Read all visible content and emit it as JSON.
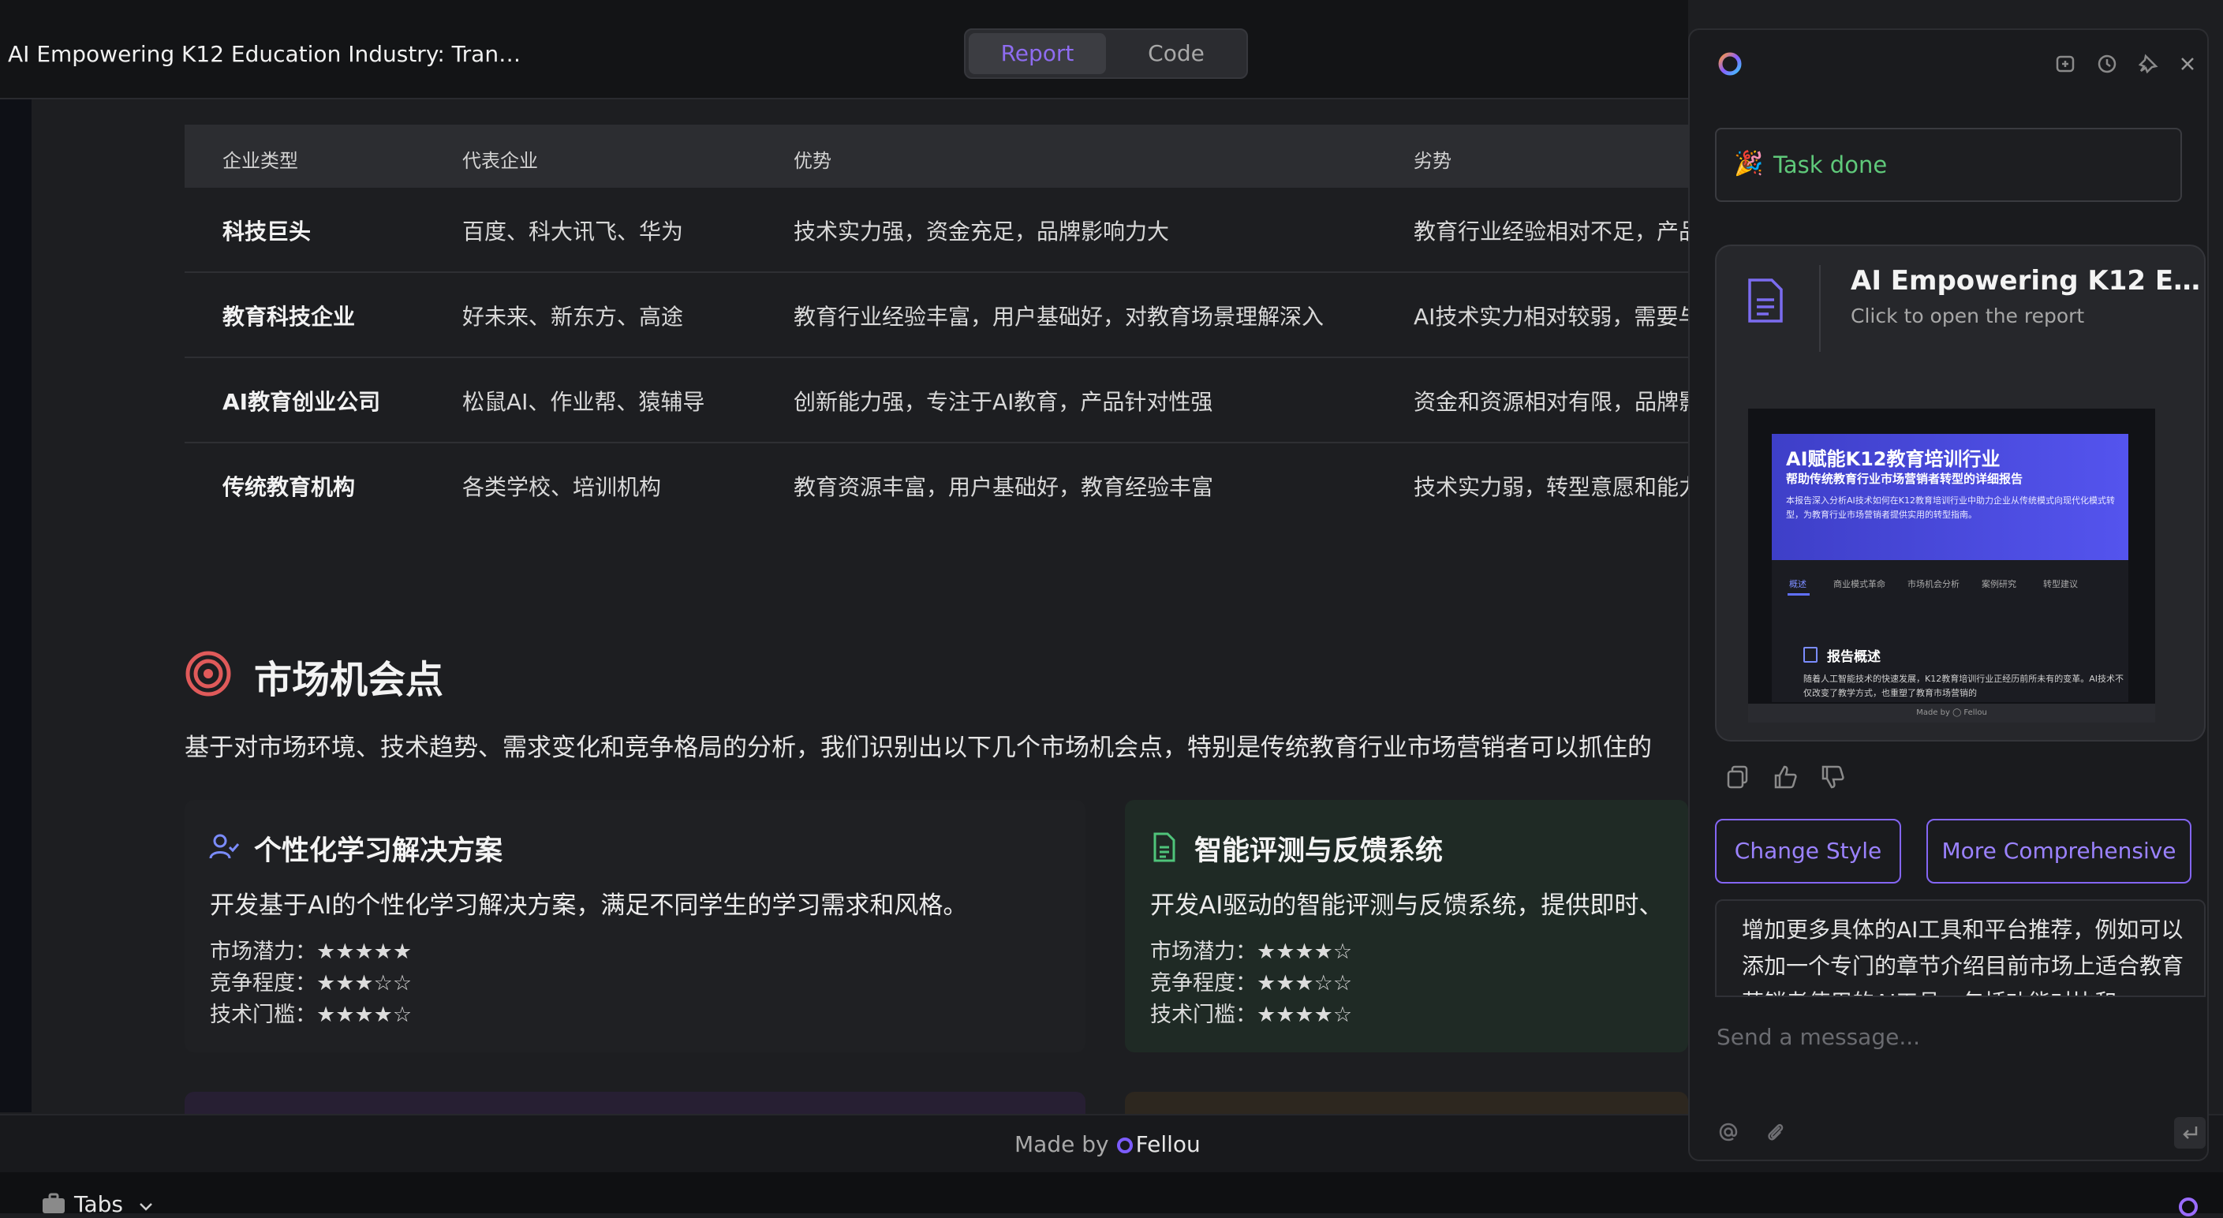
{
  "header": {
    "doc_title": "AI Empowering K12 Education Industry: Tran…",
    "tabs": {
      "report": "Report",
      "code": "Code"
    }
  },
  "table": {
    "headers": [
      "企业类型",
      "代表企业",
      "优势",
      "劣势"
    ],
    "rows": [
      [
        "科技巨头",
        "百度、科大讯飞、华为",
        "技术实力强，资金充足，品牌影响力大",
        "教育行业经验相对不足，产品"
      ],
      [
        "教育科技企业",
        "好未来、新东方、高途",
        "教育行业经验丰富，用户基础好，对教育场景理解深入",
        "AI技术实力相对较弱，需要与"
      ],
      [
        "AI教育创业公司",
        "松鼠AI、作业帮、猿辅导",
        "创新能力强，专注于AI教育，产品针对性强",
        "资金和资源相对有限，品牌影"
      ],
      [
        "传统教育机构",
        "各类学校、培训机构",
        "教育资源丰富，用户基础好，教育经验丰富",
        "技术实力弱，转型意愿和能力"
      ]
    ]
  },
  "market": {
    "title": "市场机会点",
    "description": "基于对市场环境、技术趋势、需求变化和竞争格局的分析，我们识别出以下几个市场机会点，特别是传统教育行业市场营销者可以抓住的",
    "cards": [
      {
        "title": "个性化学习解决方案",
        "desc": "开发基于AI的个性化学习解决方案，满足不同学生的学习需求和风格。",
        "potential": "市场潜力：★★★★★",
        "competition": "竞争程度：★★★☆☆",
        "barrier": "技术门槛：★★★★☆"
      },
      {
        "title": "智能评测与反馈系统",
        "desc": "开发AI驱动的智能评测与反馈系统，提供即时、",
        "potential": "市场潜力：★★★★☆",
        "competition": "竞争程度：★★★☆☆",
        "barrier": "技术门槛：★★★★☆"
      }
    ]
  },
  "footer": {
    "made_by": "Made by",
    "brand": "Fellou",
    "tabs_label": "Tabs"
  },
  "panel": {
    "task_status": "Task done",
    "task_emoji": "🎉",
    "report_card": {
      "title": "AI Empowering K12 E…",
      "subtitle": "Click to open the report",
      "thumb": {
        "title": "AI赋能K12教育培训行业",
        "subtitle": "帮助传统教育行业市场营销者转型的详细报告",
        "intro": "本报告深入分析AI技术如何在K12教育培训行业中助力企业从传统模式向现代化模式转型，为教育行业市场营销者提供实用的转型指南。",
        "nav": [
          "概述",
          "商业模式革命",
          "市场机会分析",
          "案例研究",
          "转型建议"
        ],
        "section_title": "报告概述",
        "section_body": "随着人工智能技术的快速发展，K12教育培训行业正经历前所未有的变革。AI技术不仅改变了教学方式，也重塑了教育市场营销的",
        "made_by": "Made by ◯ Fellou"
      }
    },
    "buttons": {
      "change_style": "Change Style",
      "more_comprehensive": "More Comprehensive"
    },
    "suggestion": "增加更多具体的AI工具和平台推荐，例如可以添加一个专门的章节介绍目前市场上适合教育营销者使用的AI工具，包括功能对比和",
    "input_placeholder": "Send a message...",
    "colors": {
      "accent": "#8466f4",
      "success": "#5fc97a",
      "target": "#e05a5a",
      "doc_icon": "#7b6cf0"
    }
  }
}
